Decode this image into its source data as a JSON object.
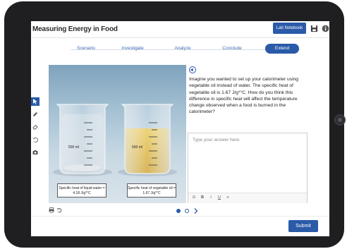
{
  "app": {
    "title": "Measuring Energy in Food"
  },
  "toolbar": {
    "lab_notebook_label": "Lab Notebook",
    "save_icon": "save-icon",
    "info_icon": "info-icon"
  },
  "tabs": [
    {
      "label": "Scenario",
      "active": false
    },
    {
      "label": "Investigate",
      "active": false
    },
    {
      "label": "Analyze",
      "active": false
    },
    {
      "label": "Conclude",
      "active": false
    },
    {
      "label": "Extend",
      "active": true
    }
  ],
  "tools": [
    "pointer-icon",
    "pencil-icon",
    "eraser-icon",
    "undo-icon",
    "camera-icon"
  ],
  "image": {
    "beakers": [
      {
        "volume_label": "500 ml",
        "caption": "Specific heat of liquid water = 4.18 J/g*°C",
        "liquid": "water"
      },
      {
        "volume_label": "500 ml",
        "caption": "Specific heat of vegetable oil = 1.67 J/g*°C",
        "liquid": "vegetable oil"
      }
    ]
  },
  "question": {
    "prompt": "Imagine you wanted to set up your calorimeter using vegetable oil instead of water. The specific heat of vegetable oil is 1.67 J/g*°C. How do you think this difference in specific heat will affect the temperature change observed when a food is burned in the calorimeter?",
    "answer_placeholder": "Type your answer here.",
    "answer_value": ""
  },
  "formatting": [
    {
      "label": "Ω",
      "name": "special-char-button"
    },
    {
      "label": "B",
      "name": "bold-button"
    },
    {
      "label": "I",
      "name": "italic-button"
    },
    {
      "label": "U",
      "name": "underline-button"
    },
    {
      "label": "≡",
      "name": "list-button"
    }
  ],
  "pager": {
    "pages": 2,
    "current": 1
  },
  "footer": {
    "submit_label": "Submit"
  },
  "colors": {
    "accent": "#2a5aa8",
    "tablet": "#1f1f22",
    "oil": "#d9b53a"
  }
}
